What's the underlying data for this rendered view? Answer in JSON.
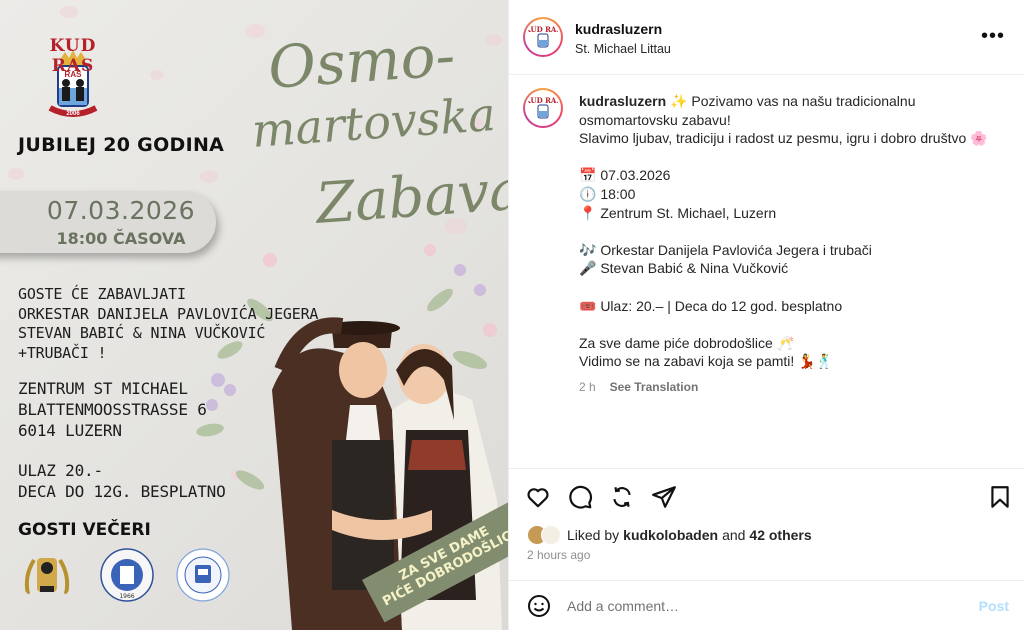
{
  "poster": {
    "logo_title": "KUD RAS",
    "logo_sub": "RAS",
    "logo_year": "2006",
    "jubilej": "JUBILEJ 20 GODINA",
    "date": "07.03.2026",
    "time": "18:00 ČASOVA",
    "title_word_1": "Osmo-",
    "title_word_2": "martovska",
    "title_word_3": "Zabava",
    "guests_lines": [
      "GOSTE ĆE ZABAVLJATI",
      "ORKESTAR DANIJELA PAVLOVIĆA JEGERA",
      "STEVAN BABIĆ & NINA VUČKOVIĆ",
      "+TRUBAČI !"
    ],
    "address_lines": [
      "ZENTRUM ST MICHAEL",
      "BLATTENMOOSSTRASSE 6",
      "6014 LUZERN"
    ],
    "entry_lines": [
      "ULAZ 20.-",
      "DECA DO 12G. BESPLATNO"
    ],
    "gosti_veceri": "GOSTI VEČERI",
    "banner_line_1": "ZA SVE DAME",
    "banner_line_2": "PIĆE DOBRODOŠLICE"
  },
  "header": {
    "username": "kudrasluzern",
    "location": "St. Michael Littau",
    "more_icon": "more-horizontal-icon"
  },
  "caption": {
    "username": "kudrasluzern",
    "line_1": "✨ Pozivamo vas na našu tradicionalnu osmomartovsku zabavu!",
    "line_2": "Slavimo ljubav, tradiciju i radost uz pesmu, igru i dobro društvo 🌸",
    "date_line": "📅 07.03.2026",
    "time_line": "🕕 18:00",
    "place_line": "📍 Zentrum St. Michael, Luzern",
    "music_line_1": "🎶 Orkestar Danijela Pavlovića Jegera i trubači",
    "music_line_2": "🎤 Stevan Babić & Nina Vučković",
    "ticket_line": "🎟️ Ulaz: 20.– | Deca do 12 god. besplatno",
    "closing_1": "Za sve dame piće dobrodošlice 🥂",
    "closing_2": "Vidimo se na zabavi koja se pamti! 💃🕺",
    "age": "2 h",
    "see_translation": "See Translation"
  },
  "actions": {
    "icons": [
      "heart-icon",
      "comment-icon",
      "repost-icon",
      "share-icon",
      "bookmark-icon"
    ]
  },
  "likes": {
    "prefix": "Liked by",
    "user": "kudkolobaden",
    "and": "and",
    "others": "42 others"
  },
  "timestamp": "2 hours ago",
  "comment": {
    "placeholder": "Add a comment…",
    "post_label": "Post"
  },
  "colors": {
    "olive_title": "#7b8768",
    "link_disabled": "#b2dffc",
    "muted": "#8e8e8e"
  }
}
